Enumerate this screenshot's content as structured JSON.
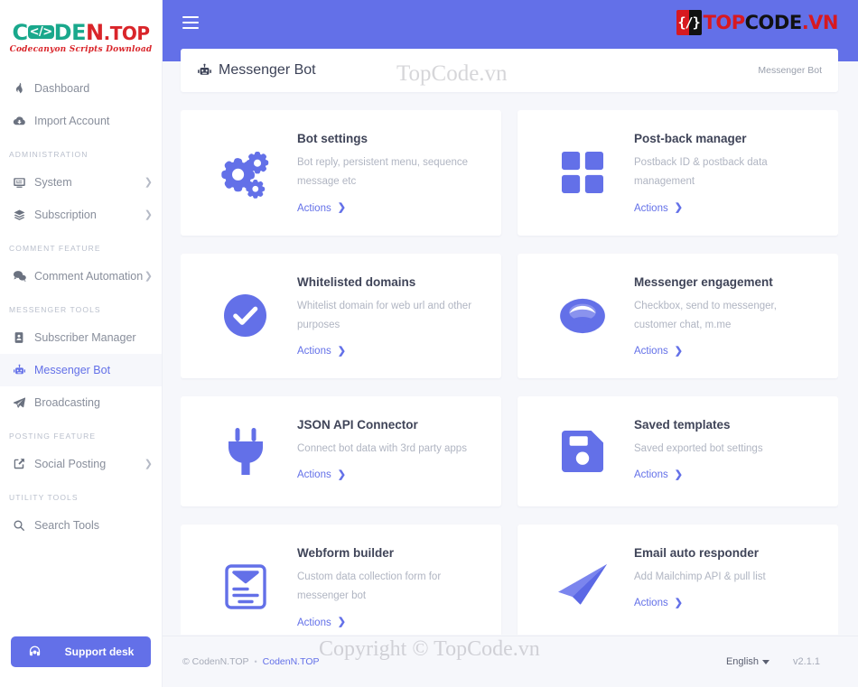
{
  "colors": {
    "accent": "#6370e8",
    "header_bg": "#6370e8",
    "content_bg": "#f6f7fb",
    "card_bg": "#ffffff",
    "brand_green": "#19a88c",
    "brand_red": "#d9252a",
    "logo_red": "#d71920",
    "logo_black": "#111111"
  },
  "sidebar": {
    "brand": {
      "c": "C",
      "bracket": "</>",
      "de": "DE",
      "n": "N",
      "top": ".TOP",
      "tagline": "Codecanyon Scripts Download"
    },
    "items": [
      {
        "label": "Dashboard",
        "icon": "fire-icon",
        "caret": false,
        "active": false,
        "section": null
      },
      {
        "label": "Import Account",
        "icon": "cloud-download-icon",
        "caret": false,
        "active": false,
        "section": null
      },
      {
        "label": "System",
        "icon": "monitor-icon",
        "caret": true,
        "active": false,
        "section": "ADMINISTRATION"
      },
      {
        "label": "Subscription",
        "icon": "layers-icon",
        "caret": true,
        "active": false,
        "section": null
      },
      {
        "label": "Comment Automation",
        "icon": "comments-icon",
        "caret": true,
        "active": false,
        "section": "COMMENT FEATURE"
      },
      {
        "label": "Subscriber Manager",
        "icon": "contact-card-icon",
        "caret": false,
        "active": false,
        "section": "MESSENGER TOOLS"
      },
      {
        "label": "Messenger Bot",
        "icon": "robot-icon",
        "caret": false,
        "active": true,
        "section": null
      },
      {
        "label": "Broadcasting",
        "icon": "paper-plane-icon",
        "caret": false,
        "active": false,
        "section": null
      },
      {
        "label": "Social Posting",
        "icon": "share-square-icon",
        "caret": true,
        "active": false,
        "section": "POSTING FEATURE"
      },
      {
        "label": "Search Tools",
        "icon": "search-icon",
        "caret": false,
        "active": false,
        "section": "UTILITY TOOLS"
      }
    ],
    "support_button": {
      "label": "Support desk",
      "icon": "headset-icon"
    }
  },
  "topbar": {
    "menu_icon": "hamburger-icon",
    "logo": {
      "badge_glyph": "{/}",
      "top": "TOP",
      "code": "CODE",
      "vn": ".VN"
    }
  },
  "page_header": {
    "icon": "robot-icon",
    "title": "Messenger Bot",
    "breadcrumb": "Messenger Bot"
  },
  "watermarks": {
    "top": "TopCode.vn",
    "bottom": "Copyright © TopCode.vn"
  },
  "cards": [
    {
      "icon": "gears-icon",
      "title": "Bot settings",
      "desc": "Bot reply, persistent menu, sequence message etc",
      "action": "Actions"
    },
    {
      "icon": "grid-squares-icon",
      "title": "Post-back manager",
      "desc": "Postback ID & postback data management",
      "action": "Actions"
    },
    {
      "icon": "check-circle-icon",
      "title": "Whitelisted domains",
      "desc": "Whitelist domain for web url and other purposes",
      "action": "Actions"
    },
    {
      "icon": "messenger-ring-icon",
      "title": "Messenger engagement",
      "desc": "Checkbox, send to messenger, customer chat, m.me",
      "action": "Actions"
    },
    {
      "icon": "plug-icon",
      "title": "JSON API Connector",
      "desc": "Connect bot data with 3rd party apps",
      "action": "Actions"
    },
    {
      "icon": "floppy-disk-icon",
      "title": "Saved templates",
      "desc": "Saved exported bot settings",
      "action": "Actions"
    },
    {
      "icon": "clipboard-form-icon",
      "title": "Webform builder",
      "desc": "Custom data collection form for messenger bot",
      "action": "Actions"
    },
    {
      "icon": "paper-plane-icon",
      "title": "Email auto responder",
      "desc": "Add Mailchimp API & pull list",
      "action": "Actions"
    }
  ],
  "footer": {
    "copyright": "© CodenN.TOP",
    "separator": "•",
    "link": "CodenN.TOP",
    "language": "English",
    "version": "v2.1.1"
  }
}
